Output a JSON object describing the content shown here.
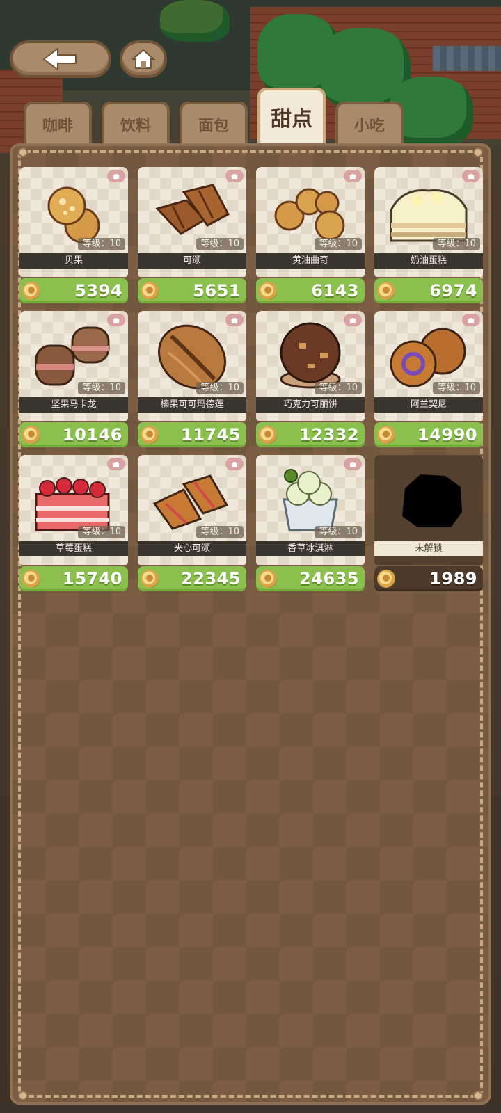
{
  "tabs": [
    {
      "label": "咖啡"
    },
    {
      "label": "饮料"
    },
    {
      "label": "面包"
    },
    {
      "label": "甜点"
    },
    {
      "label": "小吃"
    }
  ],
  "active_tab": "甜点",
  "items": [
    {
      "name": "贝果",
      "level": "等级：10",
      "price": "5394",
      "locked": false,
      "icon": "bagel-icon"
    },
    {
      "name": "可颂",
      "level": "等级：10",
      "price": "5651",
      "locked": false,
      "icon": "croissant-icon"
    },
    {
      "name": "黄油曲奇",
      "level": "等级：10",
      "price": "6143",
      "locked": false,
      "icon": "butter-cookie-icon"
    },
    {
      "name": "奶油蛋糕",
      "level": "等级：10",
      "price": "6974",
      "locked": false,
      "icon": "cream-cake-icon"
    },
    {
      "name": "坚果马卡龙",
      "level": "等级：10",
      "price": "10146",
      "locked": false,
      "icon": "macaron-icon"
    },
    {
      "name": "榛果可可玛德莲",
      "level": "等级：10",
      "price": "11745",
      "locked": false,
      "icon": "madeleine-icon"
    },
    {
      "name": "巧克力可丽饼",
      "level": "等级：10",
      "price": "12332",
      "locked": false,
      "icon": "chocolate-crepe-icon"
    },
    {
      "name": "阿兰契尼",
      "level": "等级：10",
      "price": "14990",
      "locked": false,
      "icon": "arancini-icon"
    },
    {
      "name": "草莓蛋糕",
      "level": "等级：10",
      "price": "15740",
      "locked": false,
      "icon": "strawberry-cake-icon"
    },
    {
      "name": "夹心可颂",
      "level": "等级：10",
      "price": "22345",
      "locked": false,
      "icon": "filled-croissant-icon"
    },
    {
      "name": "香草冰淇淋",
      "level": "等级：10",
      "price": "24635",
      "locked": false,
      "icon": "vanilla-ice-cream-icon"
    },
    {
      "name": "未解锁",
      "level": "",
      "price": "1989",
      "locked": true,
      "icon": "locked-silhouette-icon"
    }
  ],
  "colors": {
    "panel": "#7a5d43",
    "price_bar": "#8cc04e",
    "tab_active": "#f2e9d8",
    "tab_inactive": "#a98b6b"
  }
}
